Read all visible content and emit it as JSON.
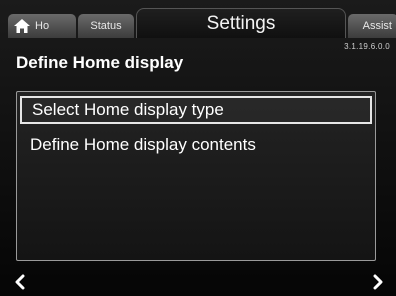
{
  "tabs": {
    "home_label": "Ho",
    "status_label": "Status",
    "settings_label": "Settings",
    "assist_label": "Assist"
  },
  "version": "3.1.19.6.0.0",
  "title": "Define Home display",
  "menu": {
    "items": [
      {
        "label": "Select Home display type",
        "selected": true
      },
      {
        "label": "Define Home display contents",
        "selected": false
      }
    ]
  },
  "icons": {
    "home": "home-icon",
    "back": "chevron-left-icon",
    "forward": "chevron-right-icon"
  }
}
